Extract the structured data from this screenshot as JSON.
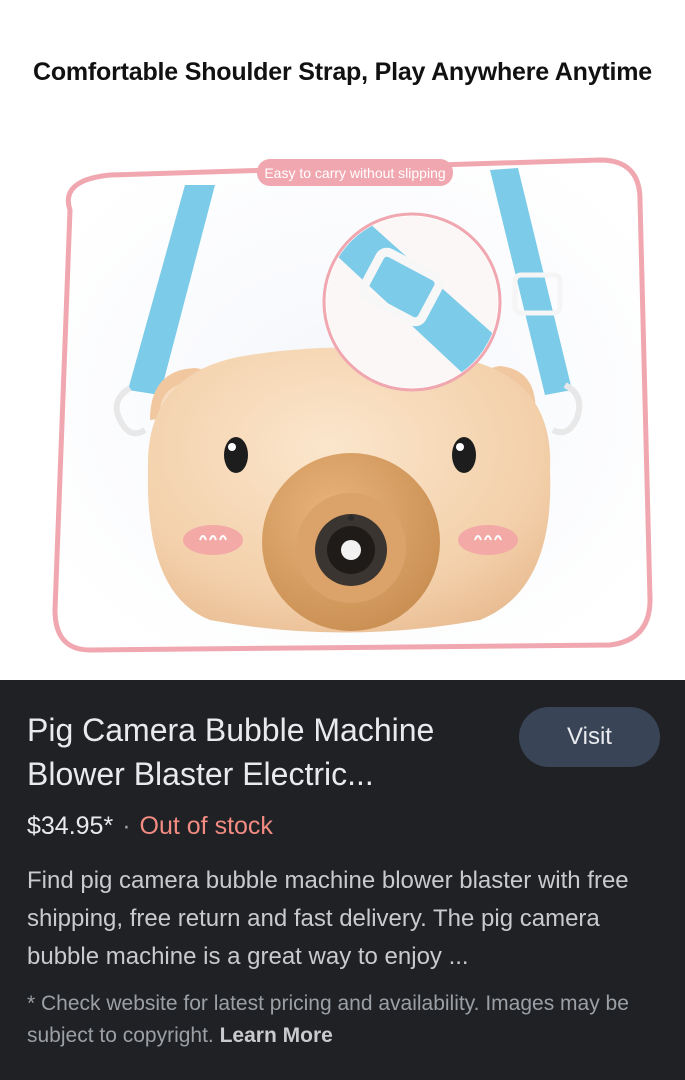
{
  "image": {
    "headline": "Comfortable Shoulder Strap, Play Anywhere Anytime",
    "badge": "Easy to carry without slipping"
  },
  "result": {
    "title": "Pig Camera Bubble Machine Blower Blaster Electric...",
    "visit_label": "Visit",
    "price": "$34.95*",
    "separator": "·",
    "stock": "Out of stock",
    "description": "Find pig camera bubble machine blower blaster with free shipping, free return and fast delivery. The pig camera bubble machine is a great way to enjoy ...",
    "disclaimer": "* Check website for latest pricing and availability. Images may be subject to copyright.",
    "learn_more": "Learn More"
  },
  "colors": {
    "panel_bg": "#202124",
    "button_bg": "#394457",
    "stock_red": "#f28b82",
    "strap_blue": "#7ccbe8",
    "frame_pink": "#f0a7b0",
    "pig_beige": "#f5d4b0"
  }
}
